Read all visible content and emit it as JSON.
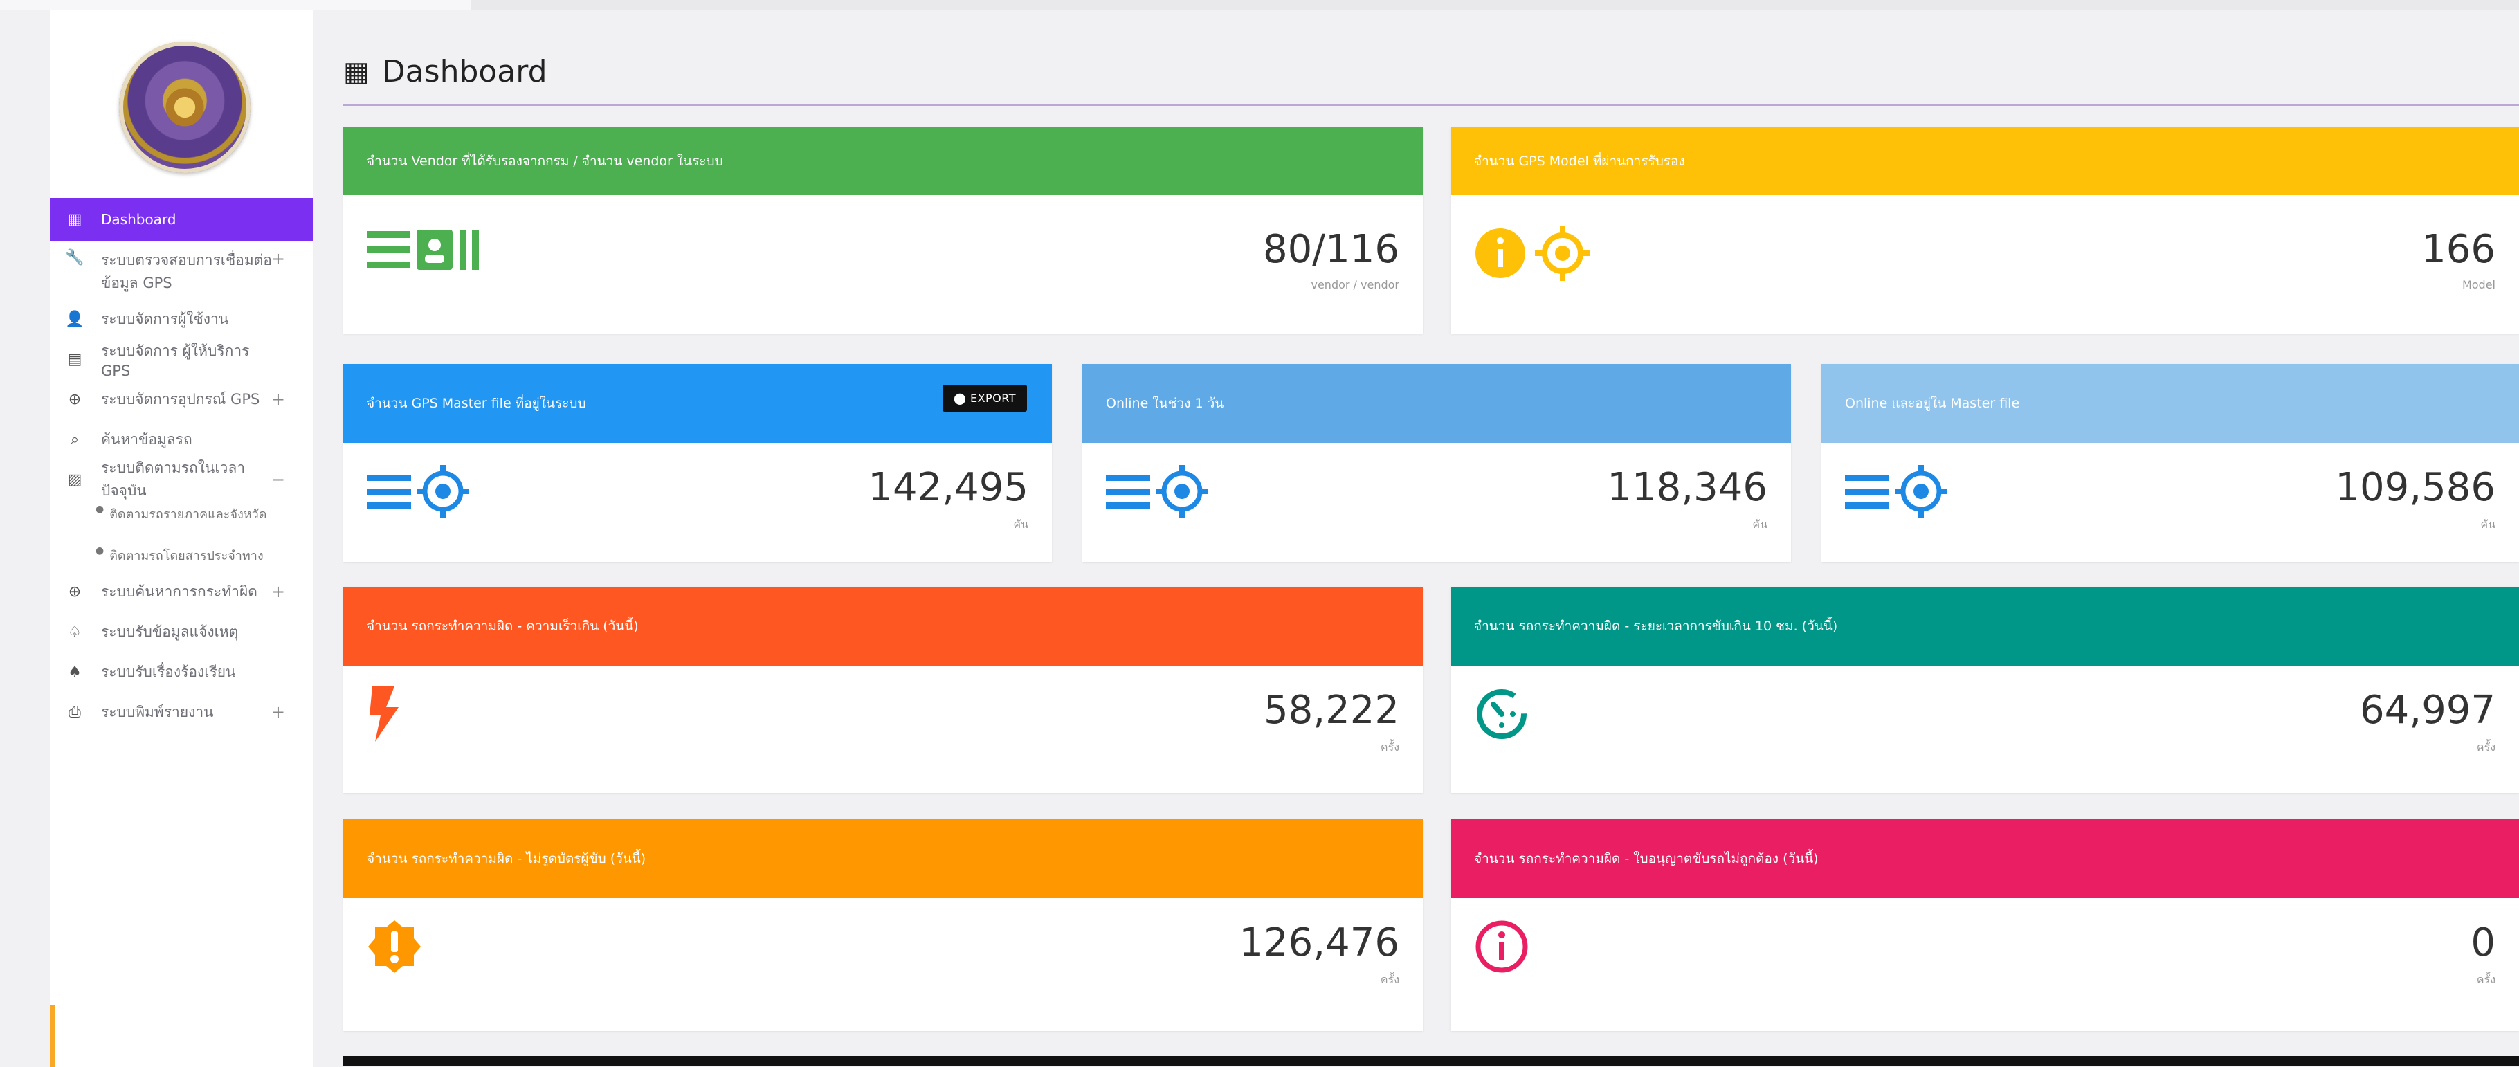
{
  "sidebar": {
    "items": [
      {
        "label": "Dashboard",
        "icon": "dashboard-icon",
        "glyph": "▦",
        "active": true
      },
      {
        "label": "ระบบตรวจสอบการเชื่อมต่อข้อมูล GPS",
        "icon": "wrench-icon",
        "glyph": "🔧",
        "expandable": true
      },
      {
        "label": "ระบบจัดการผู้ใช้งาน",
        "icon": "user-icon",
        "glyph": "👤"
      },
      {
        "label": "ระบบจัดการ ผู้ให้บริการ GPS",
        "icon": "id-card-icon",
        "glyph": "▤"
      },
      {
        "label": "ระบบจัดการอุปกรณ์ GPS",
        "icon": "crosshair-icon",
        "glyph": "⊕",
        "expandable": true
      },
      {
        "label": "ค้นหาข้อมูลรถ",
        "icon": "search-icon",
        "glyph": "⌕"
      },
      {
        "label": "ระบบติดตามรถในเวลาปัจจุบัน",
        "icon": "map-icon",
        "glyph": "▨",
        "expandable": true,
        "expanded": true
      }
    ],
    "subitems": [
      {
        "label": "ติดตามรถรายภาคและจังหวัด"
      },
      {
        "label": "ติดตามรถโดยสารประจำทาง"
      }
    ],
    "items_after": [
      {
        "label": "ระบบค้นหาการกระทำผิด",
        "icon": "crosshair2-icon",
        "glyph": "⊕",
        "expandable": true
      },
      {
        "label": "ระบบรับข้อมูลแจ้งเหตุ",
        "icon": "bell-outline-icon",
        "glyph": "♤"
      },
      {
        "label": "ระบบรับเรื่องร้องเรียน",
        "icon": "bell-icon",
        "glyph": "♠"
      },
      {
        "label": "ระบบพิมพ์รายงาน",
        "icon": "print-icon",
        "glyph": "⎙",
        "expandable": true
      }
    ]
  },
  "header": {
    "title": "Dashboard",
    "icon": "dashboard-icon"
  },
  "cards": {
    "vendor": {
      "title": "จำนวน Vendor ที่ได้รับรองจากกรม / จำนวน vendor ในระบบ",
      "value": "80/116",
      "unit": "vendor / vendor",
      "color": "#4caf50",
      "icon": "vendor-list-icon"
    },
    "gps_model": {
      "title": "จำนวน GPS Model ที่ผ่านการรับรอง",
      "value": "166",
      "unit": "Model",
      "color": "#ffc107",
      "icon": "info-target-icon"
    },
    "master_file": {
      "title": "จำนวน GPS Master file ที่อยู่ในระบบ",
      "value": "142,495",
      "unit": "คัน",
      "color": "#2196f3",
      "icon": "list-target-icon",
      "export_label": "EXPORT"
    },
    "online_1day": {
      "title": "Online ในช่วง 1 วัน",
      "value": "118,346",
      "unit": "คัน",
      "color": "#5ea9e6",
      "icon": "list-target-icon"
    },
    "online_master": {
      "title": "Online และอยู่ใน Master file",
      "value": "109,586",
      "unit": "คัน",
      "color": "#90c4ec",
      "icon": "list-target-icon"
    },
    "speeding": {
      "title": "จำนวน รถกระทำความผิด - ความเร็วเกิน (วันนี้)",
      "value": "58,222",
      "unit": "ครั้ง",
      "color": "#ff5722",
      "icon": "bolt-icon"
    },
    "drive_time": {
      "title": "จำนวน รถกระทำความผิด - ระยะเวลาการขับเกิน 10 ชม. (วันนี้)",
      "value": "64,997",
      "unit": "ครั้ง",
      "color": "#009688",
      "icon": "timer-icon"
    },
    "no_card": {
      "title": "จำนวน รถกระทำความผิด - ไม่รูดบัตรผู้ขับ (วันนี้)",
      "value": "126,476",
      "unit": "ครั้ง",
      "color": "#ff9800",
      "icon": "alert-badge-icon"
    },
    "license_type": {
      "title": "จำนวน รถกระทำความผิด - ใบอนุญาตขับรถไม่ถูกต้อง (วันนี้)",
      "value": "0",
      "unit": "ครั้ง",
      "color": "#e91e63",
      "icon": "info-circle-icon"
    }
  }
}
